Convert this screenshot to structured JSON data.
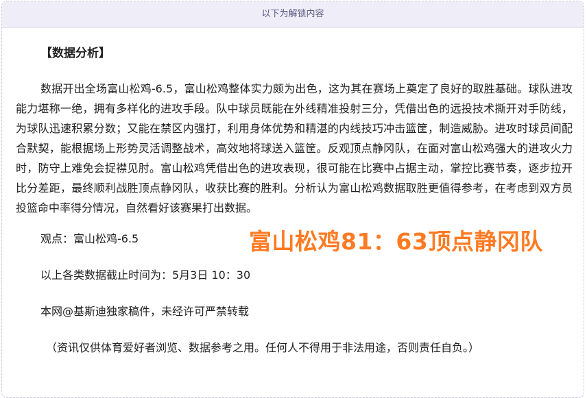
{
  "banner": {
    "text": "以下为解锁内容"
  },
  "article": {
    "heading": "【数据分析】",
    "paragraph": "数据开出全场富山松鸡-6.5，富山松鸡整体实力颇为出色，这为其在赛场上奠定了良好的取胜基础。球队进攻能力堪称一绝，拥有多样化的进攻手段。队中球员既能在外线精准投射三分，凭借出色的远投技术撕开对手防线，为球队迅速积累分数；又能在禁区内强打，利用身体优势和精湛的内线技巧冲击篮筐，制造威胁。进攻时球员间配合默契，能根据场上形势灵活调整战术，高效地将球送入篮筐。反观顶点静冈队，在面对富山松鸡强大的进攻火力时，防守上难免会捉襟见肘。富山松鸡凭借出色的进攻表现，很可能在比赛中占据主动，掌控比赛节奏，逐步拉开比分差距，最终顺利战胜顶点静冈队，收获比赛的胜利。分析认为富山松鸡数据取胜更值得参考，在考虑到双方员投篮命中率得分情况，自然看好该赛果打出数据。",
    "viewpoint": "观点：富山松鸡-6.5",
    "score_overlay": "富山松鸡81：63顶点静冈队",
    "cutoff": "以上各类数据截止时间为：5月3日 10：30",
    "copyright": "本网@基斯迪独家稿件，未经许可严禁转载",
    "disclaimer": "（资讯仅供体育爱好者浏览、数据参考之用。任何人不得用于非法用途，否则责任自负。）"
  },
  "colors": {
    "banner_bg": "#efeef8",
    "banner_text": "#5a5680",
    "score_text": "#ff7a21",
    "body_text": "#222222"
  }
}
